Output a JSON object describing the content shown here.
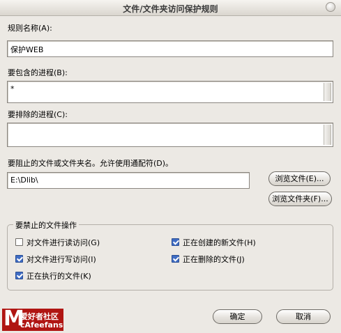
{
  "window": {
    "title": "文件/文件夹访问保护规则"
  },
  "rule_name": {
    "label": "规则名称(A):",
    "value": "保护WEB"
  },
  "include": {
    "label": "要包含的进程(B):",
    "value": "*"
  },
  "exclude": {
    "label": "要排除的进程(C):",
    "value": ""
  },
  "block": {
    "label": "要阻止的文件或文件夹名。允许使用通配符(D)。",
    "value": "E:\\Dlib\\",
    "browse_file": "浏览文件(E)...",
    "browse_folder": "浏览文件夹(F)..."
  },
  "operations": {
    "title": "要禁止的文件操作",
    "items": [
      {
        "label": "对文件进行读访问(G)",
        "checked": false
      },
      {
        "label": "正在创建的新文件(H)",
        "checked": true
      },
      {
        "label": "对文件进行写访问(I)",
        "checked": true
      },
      {
        "label": "正在删除的文件(J)",
        "checked": true
      },
      {
        "label": "正在执行的文件(K)",
        "checked": true
      }
    ]
  },
  "logo": {
    "top": "爱好者社区",
    "bottom": "cAfeefans",
    "letter": "M"
  },
  "buttons": {
    "ok": "确定",
    "cancel": "取消"
  }
}
